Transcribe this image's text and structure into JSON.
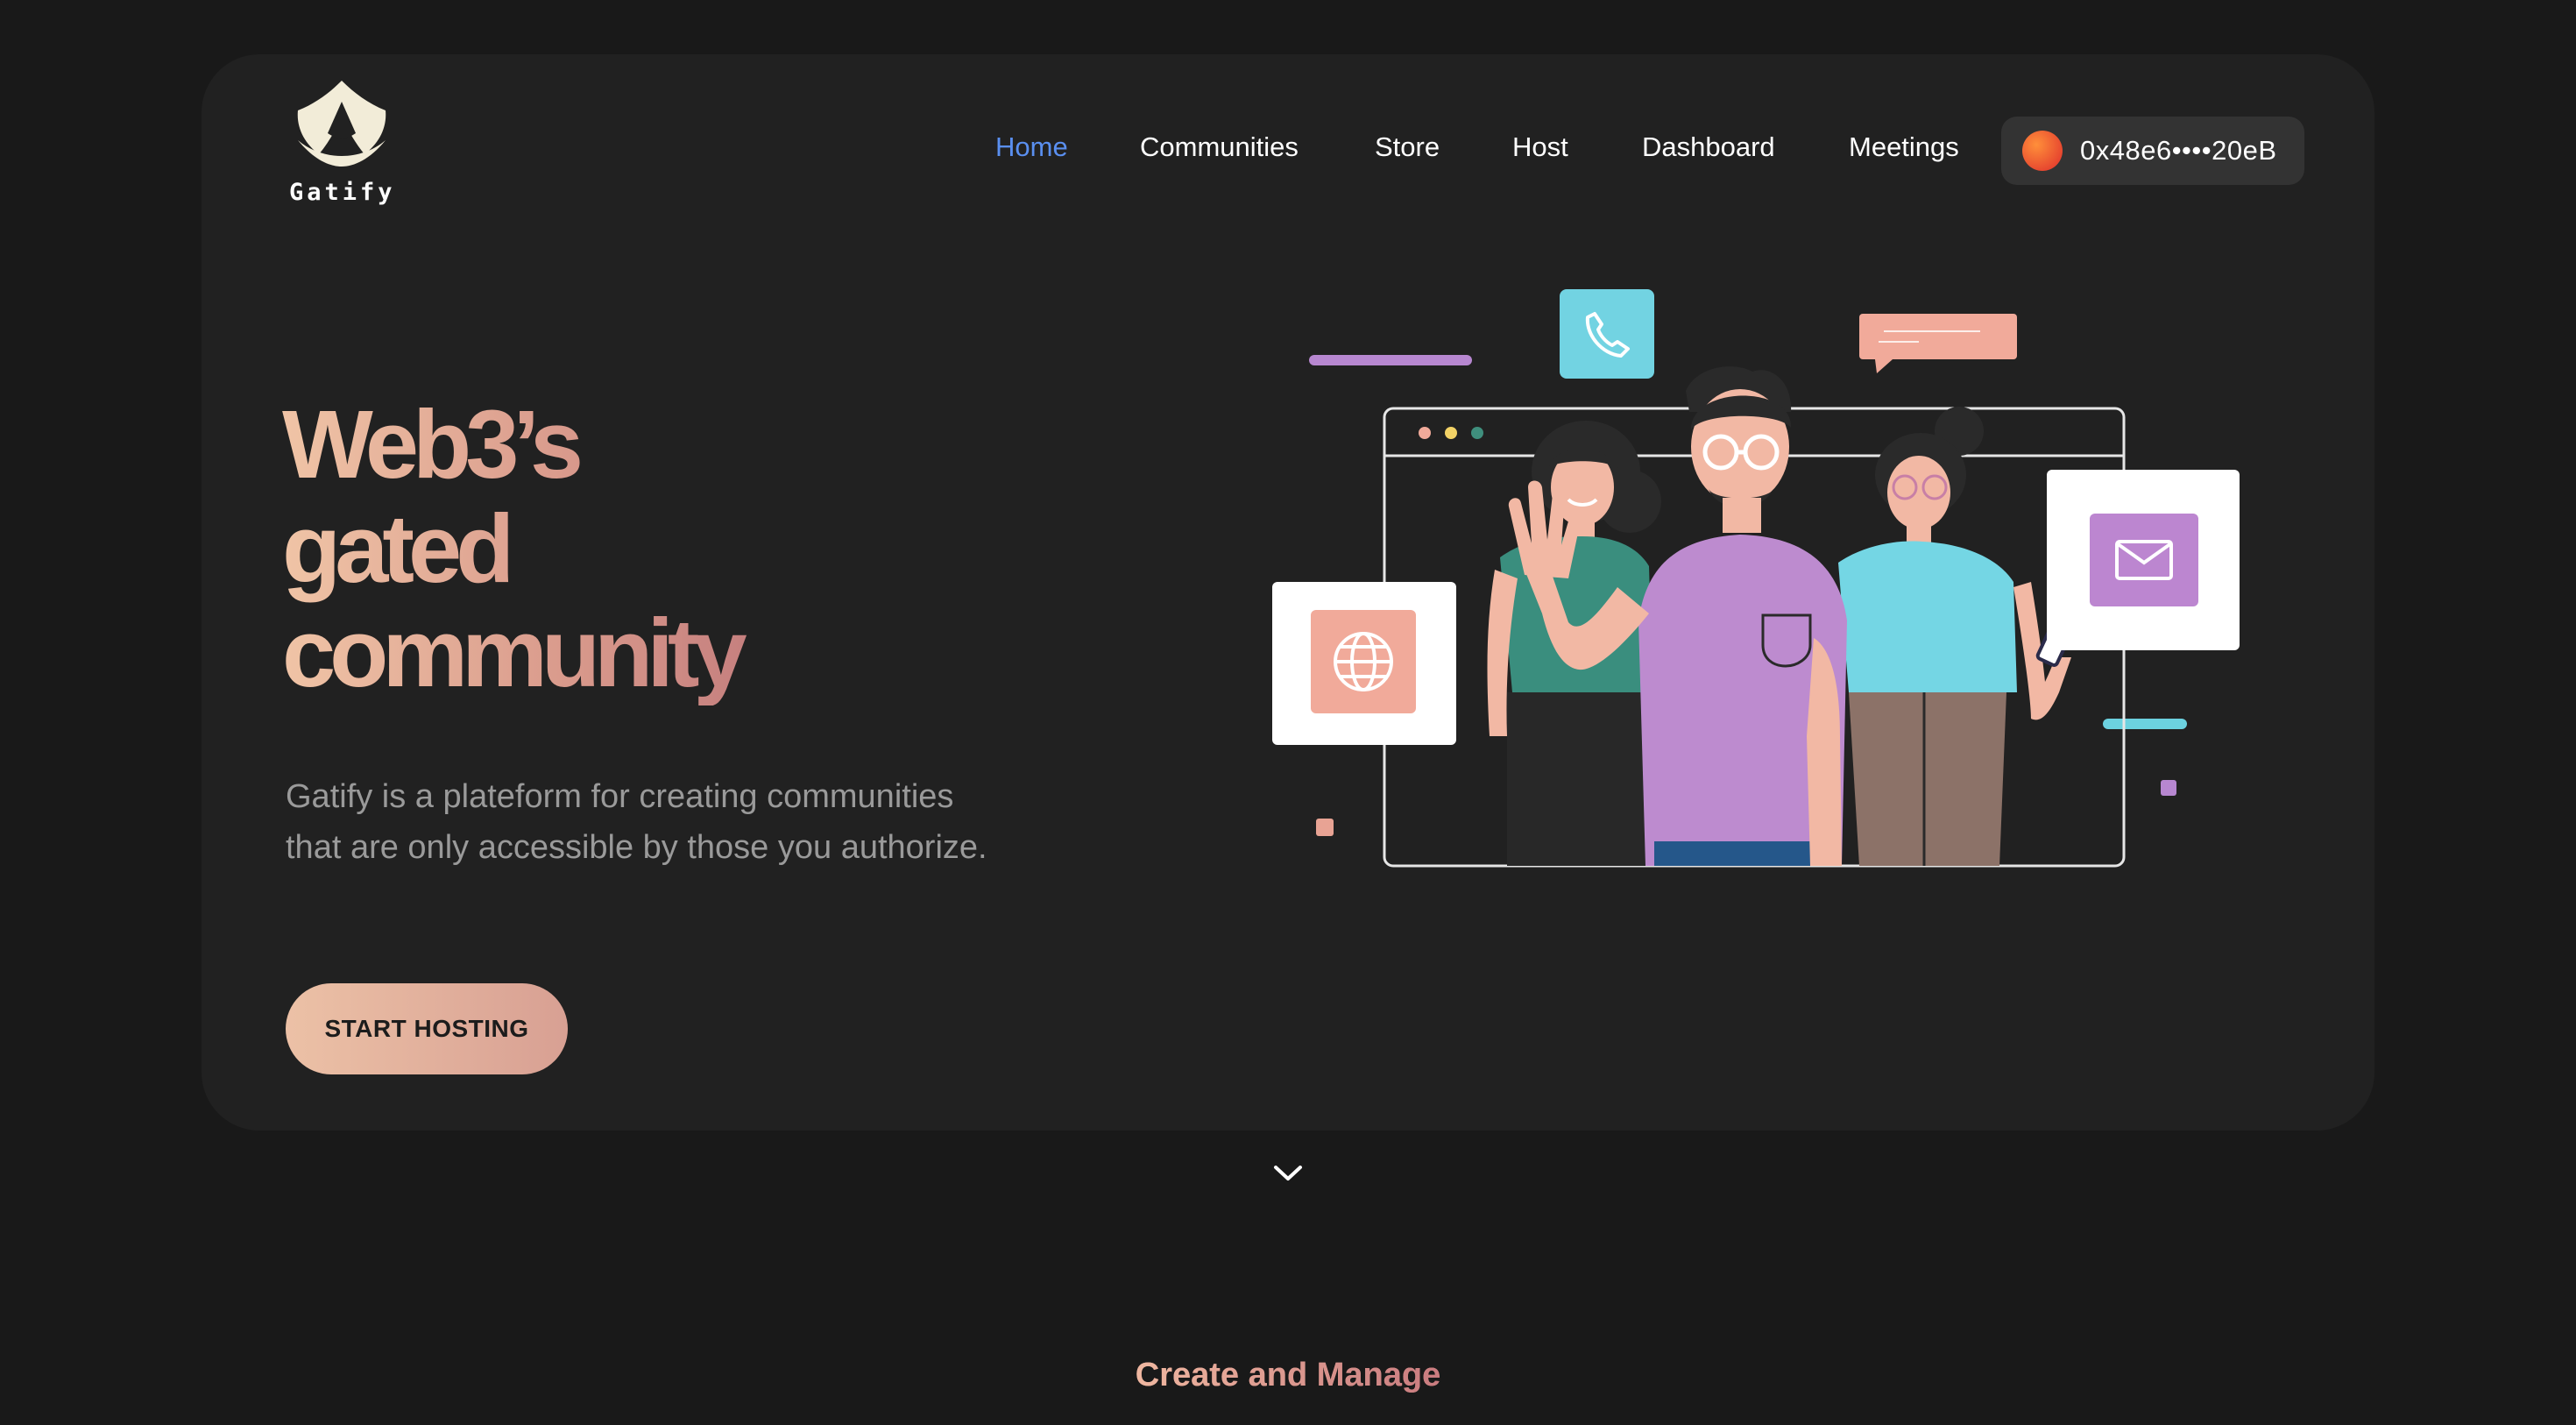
{
  "brand": {
    "name": "Gatify"
  },
  "nav": {
    "items": [
      {
        "label": "Home",
        "active": true
      },
      {
        "label": "Communities",
        "active": false
      },
      {
        "label": "Store",
        "active": false
      },
      {
        "label": "Host",
        "active": false
      },
      {
        "label": "Dashboard",
        "active": false
      },
      {
        "label": "Meetings",
        "active": false
      }
    ],
    "active_color": "#5a8ff0"
  },
  "wallet": {
    "address": "0x48e6••••20eB"
  },
  "hero": {
    "headline": [
      "Web3’s",
      "gated",
      "community"
    ],
    "subtitle_lines": [
      "Gatify is a plateform for creating communities",
      "that are only accessible by those you authorize."
    ],
    "cta_label": "START HOSTING",
    "illustration": "people-waving-in-browser-window-with-phone-chat-globe-mail-icons"
  },
  "scroll_hint": {
    "icon": "chevron-down-icon"
  },
  "next_section": {
    "title": "Create and Manage"
  },
  "colors": {
    "page_background": "#191919",
    "card_background": "#212121",
    "accent_gradient_start": "#ecc1a6",
    "accent_gradient_end": "#b46872"
  }
}
